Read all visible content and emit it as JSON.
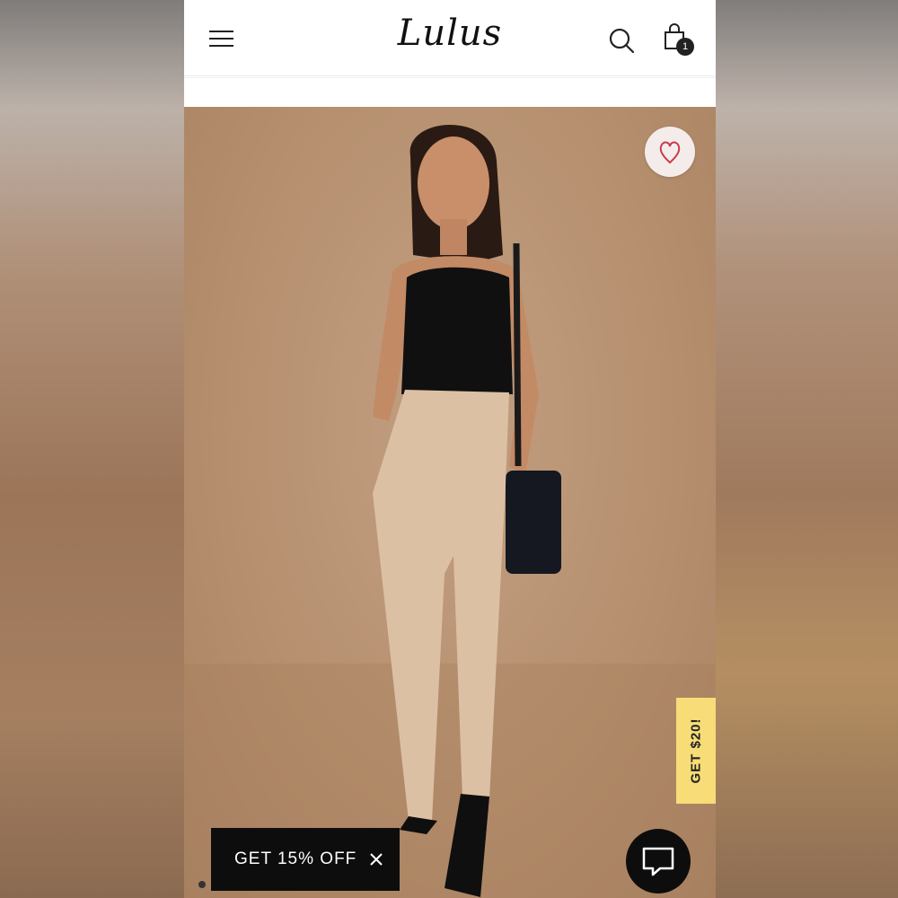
{
  "header": {
    "logo_text": "Lulus",
    "cart_count": "1",
    "menu_icon": "hamburger-menu-icon",
    "search_icon": "search-icon",
    "cart_icon": "shopping-bag-icon"
  },
  "product": {
    "image_alt": "Model wearing black lace cami and beige trousers",
    "wishlist_icon": "heart-icon"
  },
  "promo": {
    "side_tab_label": "GET $20!",
    "side_tab_color": "#f7dc78",
    "bottom_bar_label": "GET 15% OFF",
    "close_icon": "close-icon",
    "chat_icon": "chat-icon"
  },
  "carousel": {
    "current_index": 1
  }
}
